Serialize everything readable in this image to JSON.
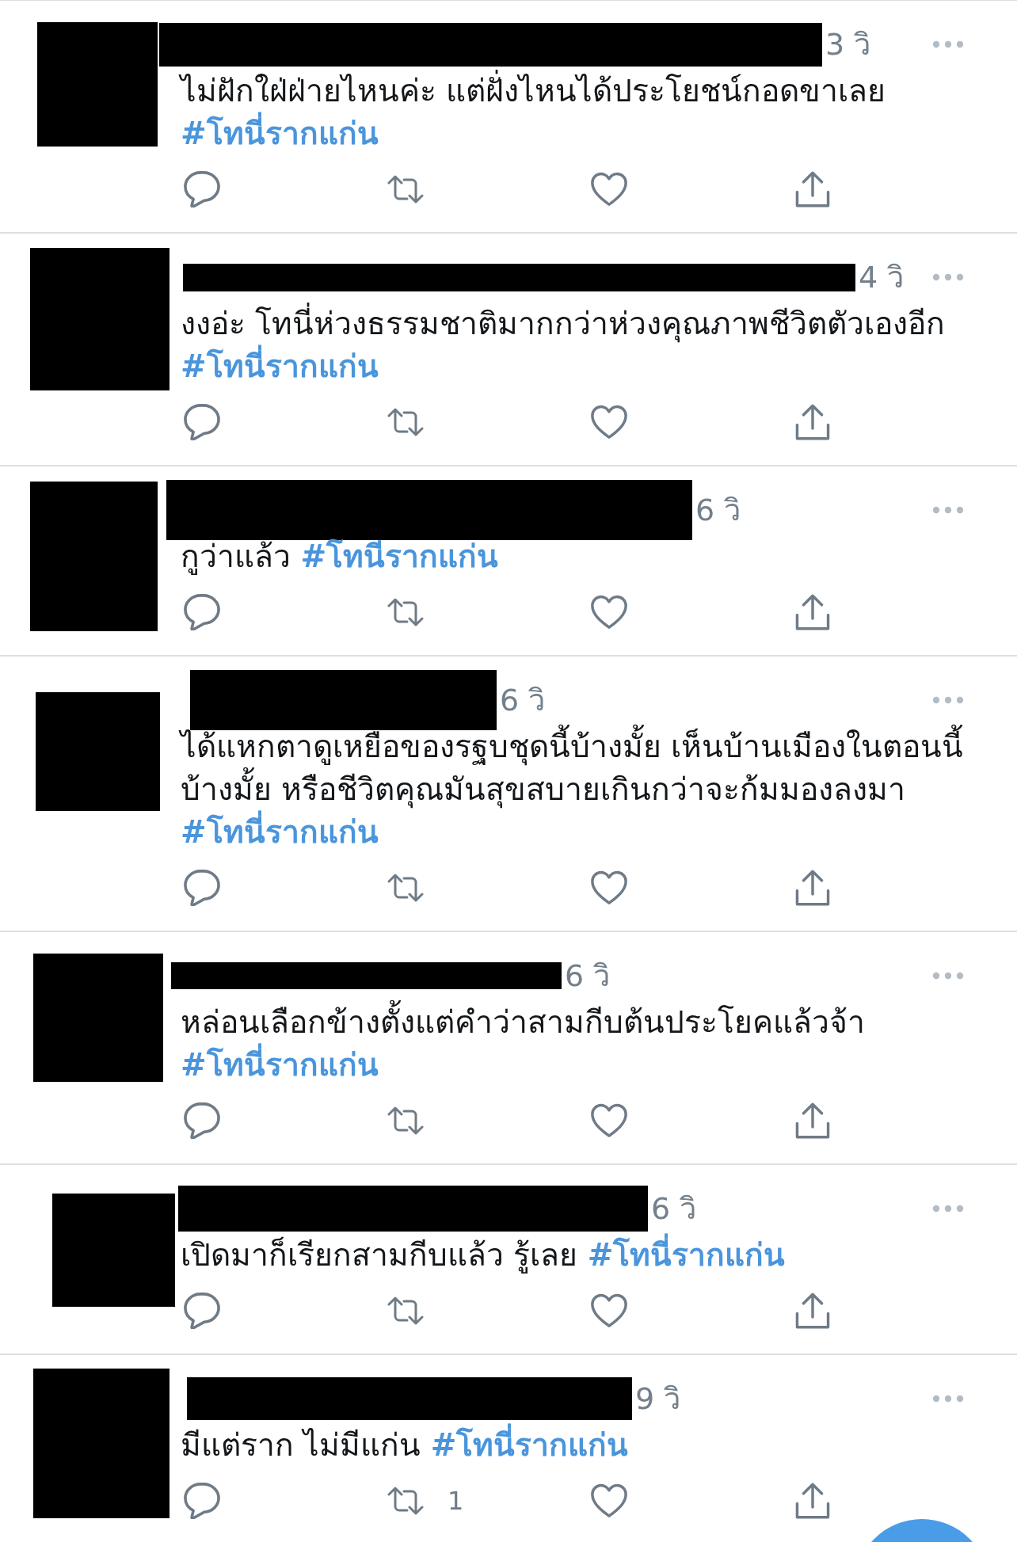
{
  "tweets": [
    {
      "time": "3 วิ",
      "text": "ไม่ฝักใฝ่ฝ่ายไหนค่ะ แต่ฝั่งไหนได้ประโยชน์กอดขาเลย",
      "hashtag": "#โทนี่รากแก่น"
    },
    {
      "time": "4 วิ",
      "text": "งงอ่ะ โทนี่ห่วงธรรมชาติมากกว่าห่วงคุณภาพชีวิตตัวเองอีก",
      "hashtag": "#โทนี่รากแก่น"
    },
    {
      "time": "6 วิ",
      "text": "กูว่าแล้ว",
      "hashtag": "#โทนีรากแก่น"
    },
    {
      "time": "6 วิ",
      "text": "ได้แหกตาดูเหยือของรฐบชุดนี้บ้างมั้ย เห็นบ้านเมืองในตอนนี้บ้างมั้ย หรือชีวิตคุณมันสุขสบายเกินกว่าจะก้มมองลงมา",
      "hashtag": "#โทนี่รากแก่น"
    },
    {
      "time": "6 วิ",
      "text": "หล่อนเลือกข้างตั้งแต่คำว่าสามกีบต้นประโยคแล้วจ้า",
      "hashtag": "#โทนี่รากแก่น"
    },
    {
      "time": "6 วิ",
      "text": "เปิดมาก็เรียกสามกีบแล้ว รู้เลย",
      "hashtag": "#โทนี่รากแก่น"
    },
    {
      "time": "9 วิ",
      "text": "มีแต่ราก ไม่มีแก่น",
      "hashtag": "#โทนี่รากแก่น",
      "retweet_count": "1"
    }
  ]
}
